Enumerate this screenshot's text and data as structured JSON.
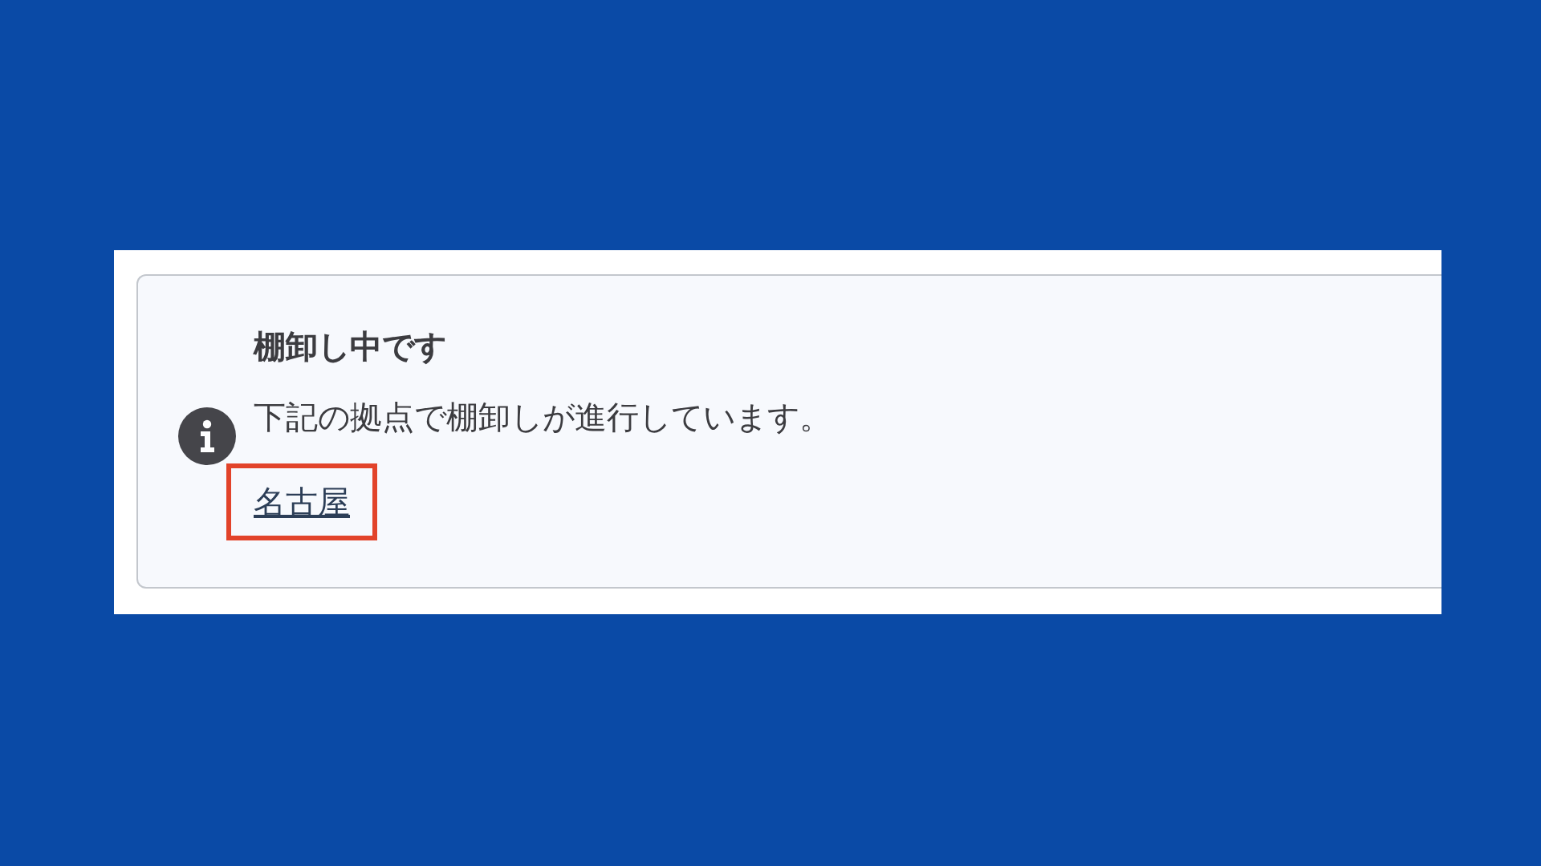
{
  "alert": {
    "title": "棚卸し中です",
    "message": "下記の拠点で棚卸しが進行しています。",
    "links": [
      {
        "label": "名古屋",
        "highlighted": true
      }
    ]
  }
}
